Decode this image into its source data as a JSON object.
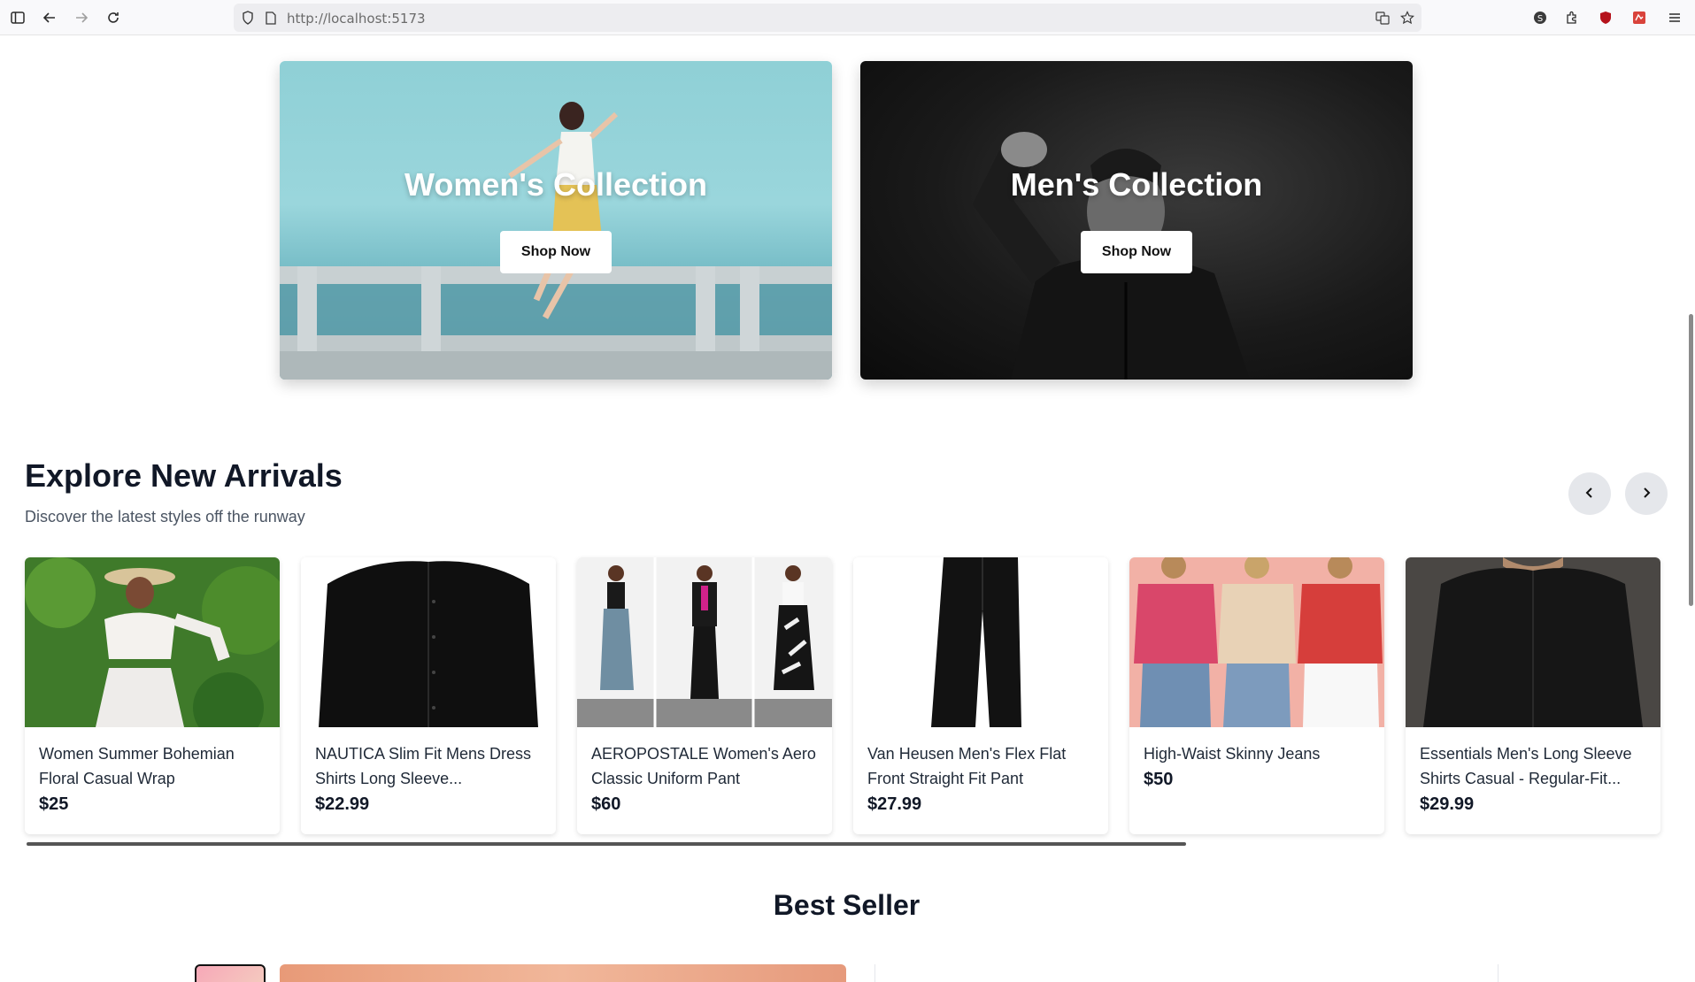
{
  "browser": {
    "url_scheme": "http://",
    "url_host": "localhost",
    "url_port": ":5173"
  },
  "collections": [
    {
      "title": "Women's Collection",
      "button": "Shop Now"
    },
    {
      "title": "Men's Collection",
      "button": "Shop Now"
    }
  ],
  "new_arrivals": {
    "title": "Explore New Arrivals",
    "subtitle": "Discover the latest styles off the runway",
    "prev_icon": "chevron-left-icon",
    "next_icon": "chevron-right-icon",
    "products": [
      {
        "name": "Women Summer Bohemian Floral Casual Wrap",
        "price": "$25"
      },
      {
        "name": "NAUTICA Slim Fit Mens Dress Shirts Long Sleeve...",
        "price": "$22.99"
      },
      {
        "name": "AEROPOSTALE Women's Aero Classic Uniform Pant",
        "price": "$60"
      },
      {
        "name": "Van Heusen Men's Flex Flat Front Straight Fit Pant",
        "price": "$27.99"
      },
      {
        "name": "High-Waist Skinny Jeans",
        "price": "$50"
      },
      {
        "name": "Essentials Men's Long Sleeve Shirts Casual - Regular-Fit...",
        "price": "$29.99"
      }
    ]
  },
  "best_seller": {
    "title": "Best Seller"
  }
}
